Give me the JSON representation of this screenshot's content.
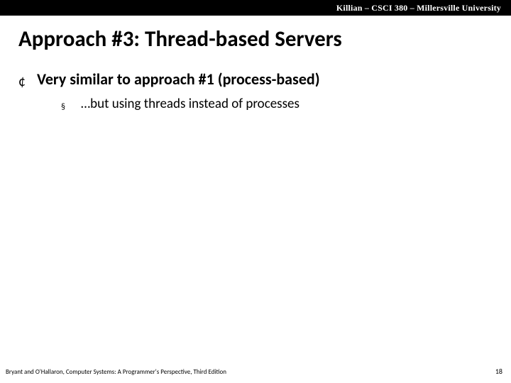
{
  "header": {
    "course": "Killian – CSCI 380 – Millersville University"
  },
  "title": "Approach #3: Thread-based Servers",
  "bullets": {
    "lvl1_symbol": "¢",
    "lvl1_text": "Very similar to approach #1 (process-based)",
    "lvl2_symbol": "§",
    "lvl2_text": "…but using threads instead of processes"
  },
  "footer": {
    "citation": "Bryant and O'Hallaron, Computer Systems: A Programmer's Perspective, Third Edition",
    "page": "18"
  }
}
